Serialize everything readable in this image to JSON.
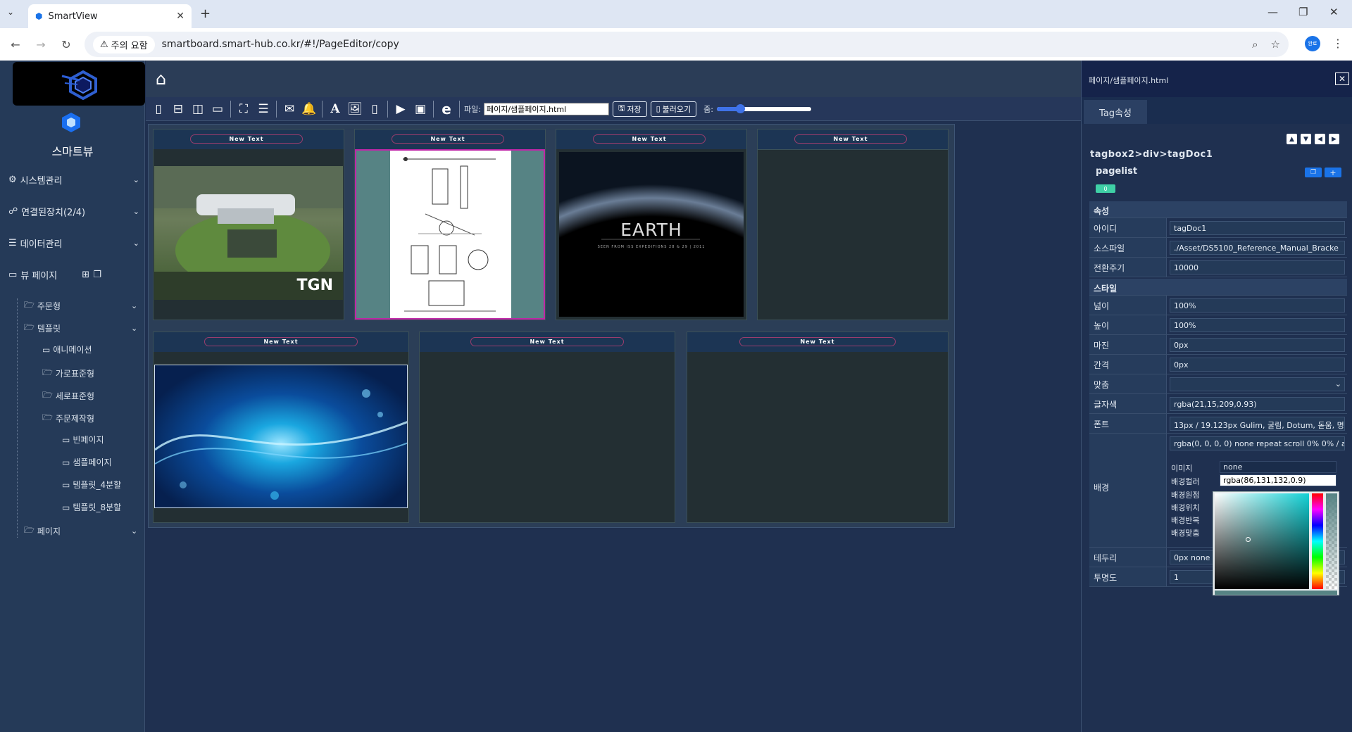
{
  "browser": {
    "tab_title": "SmartView",
    "url": "smartboard.smart-hub.co.kr/#!/PageEditor/copy",
    "security_warning": "주의 요함",
    "profile_label": "완료"
  },
  "sidebar": {
    "brand": "스마트뷰",
    "menu": [
      {
        "label": "시스템관리"
      },
      {
        "label": "연결된장치(2/4)"
      },
      {
        "label": "데이터관리"
      },
      {
        "label": "뷰 페이지"
      }
    ],
    "tree": [
      {
        "label": "주문형"
      },
      {
        "label": "템플릿"
      },
      {
        "label": "애니메이션"
      },
      {
        "label": "가로표준형"
      },
      {
        "label": "세로표준형"
      },
      {
        "label": "주문제작형"
      },
      {
        "label": "빈페이지"
      },
      {
        "label": "샘플페이지"
      },
      {
        "label": "템플릿_4분할"
      },
      {
        "label": "템플릿_8분할"
      },
      {
        "label": "페이지"
      }
    ]
  },
  "toolbar": {
    "file_label": "파일:",
    "file_value": "페이지/샘플페이지.html",
    "save_label": "저장",
    "load_label": "불러오기",
    "zoom_label": "줌:",
    "zoom_value": 0.25
  },
  "panels": [
    {
      "title": "New Text",
      "media": "building"
    },
    {
      "title": "New Text",
      "media": "document"
    },
    {
      "title": "New Text",
      "media": "earth"
    },
    {
      "title": "New Text",
      "media": "empty"
    },
    {
      "title": "New Text",
      "media": "waves"
    },
    {
      "title": "New Text",
      "media": "empty"
    },
    {
      "title": "New Text",
      "media": "empty"
    }
  ],
  "media_text": {
    "tgn": "TGN",
    "earth_title": "EARTH",
    "earth_subtitle": "SEEN FROM ISS EXPEDITIONS 28 & 29 | 2011"
  },
  "right_panel": {
    "file_path": "페이지/샘플페이지.html",
    "tab": "Tag속성",
    "breadcrumb": "tagbox2>div>tagDoc1",
    "component": "pagelist",
    "badge": "0",
    "sections": {
      "attr": "속성",
      "style": "스타일"
    },
    "attrs": [
      {
        "label": "아이디",
        "value": "tagDoc1"
      },
      {
        "label": "소스파일",
        "value": "./Asset/DS5100_Reference_Manual_Bracke"
      },
      {
        "label": "전환주기",
        "value": "10000"
      }
    ],
    "styles": [
      {
        "label": "넓이",
        "value": "100%"
      },
      {
        "label": "높이",
        "value": "100%"
      },
      {
        "label": "마진",
        "value": "0px"
      },
      {
        "label": "간격",
        "value": "0px"
      },
      {
        "label": "맞춤",
        "value": ""
      },
      {
        "label": "글자색",
        "value": "rgba(21,15,209,0.93)"
      },
      {
        "label": "폰트",
        "value": "13px / 19.123px Gulim, 굴림, Dotum, 돋움, 명:"
      }
    ],
    "background": {
      "label": "배경",
      "value": "rgba(0, 0, 0, 0) none repeat scroll 0% 0% / a",
      "rows": [
        {
          "label": "이미지",
          "value": "none"
        },
        {
          "label": "배경컬러",
          "value": "rgba(86,131,132,0.9)"
        },
        {
          "label": "배경원점",
          "value": ""
        },
        {
          "label": "배경위치",
          "value": ""
        },
        {
          "label": "배경반복",
          "value": ""
        },
        {
          "label": "배경맞춤",
          "value": ""
        }
      ]
    },
    "border": {
      "label": "테두리",
      "value": "0px none r"
    },
    "opacity": {
      "label": "투명도",
      "value": "1"
    }
  },
  "colors": {
    "accent": "#1a73e8",
    "selected_border": "#c026a8",
    "doc_bg": "#568384"
  }
}
